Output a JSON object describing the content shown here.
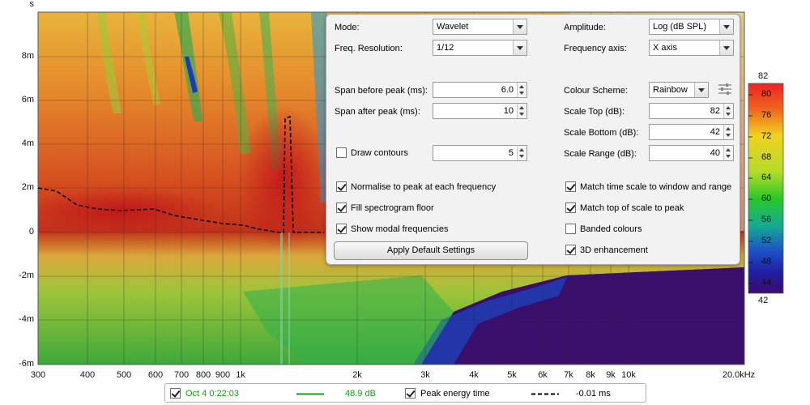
{
  "plot": {
    "y_unit_label": "s",
    "y_ticks": [
      "8m",
      "6m",
      "4m",
      "2m",
      "0",
      "-2m",
      "-4m",
      "-6m"
    ],
    "x_ticks": [
      "300",
      "400",
      "500",
      "600",
      "700",
      "800",
      "900",
      "1k",
      "2k",
      "3k",
      "4k",
      "5k",
      "6k",
      "7k",
      "8k",
      "9k",
      "10k",
      "20.0kHz"
    ]
  },
  "colorbar": {
    "max_label": "82",
    "min_label": "42",
    "tick_labels": [
      "80",
      "76",
      "72",
      "68",
      "64",
      "60",
      "56",
      "52",
      "48",
      "44"
    ]
  },
  "panel": {
    "mode_label": "Mode:",
    "mode_value": "Wavelet",
    "amplitude_label": "Amplitude:",
    "amplitude_value": "Log (dB SPL)",
    "freq_res_label": "Freq. Resolution:",
    "freq_res_value": "1/12",
    "freq_axis_label": "Frequency axis:",
    "freq_axis_value": "X axis",
    "span_before_label": "Span before peak (ms):",
    "span_before_value": "6.0",
    "span_after_label": "Span after peak (ms):",
    "span_after_value": "10",
    "colour_scheme_label": "Colour Scheme:",
    "colour_scheme_value": "Rainbow",
    "scale_top_label": "Scale Top (dB):",
    "scale_top_value": "82",
    "scale_bottom_label": "Scale Bottom (dB):",
    "scale_bottom_value": "42",
    "scale_range_label": "Scale Range (dB):",
    "scale_range_value": "40",
    "draw_contours_label": "Draw contours",
    "contours_value": "5",
    "normalise_label": "Normalise to peak at each frequency",
    "fill_floor_label": "Fill spectrogram floor",
    "modal_label": "Show modal frequencies",
    "match_time_label": "Match time scale to window and range",
    "match_top_label": "Match top of scale to peak",
    "banded_label": "Banded colours",
    "enhance_label": "3D enhancement",
    "apply_label": "Apply Default Settings"
  },
  "legend": {
    "series_name": "Oct 4 0:22:03",
    "series_value": "48.9 dB",
    "peak_label": "Peak energy time",
    "peak_value": "-0.01 ms"
  },
  "colors": {
    "series_green": "#1a9c1a",
    "peak_line": "#000000"
  }
}
